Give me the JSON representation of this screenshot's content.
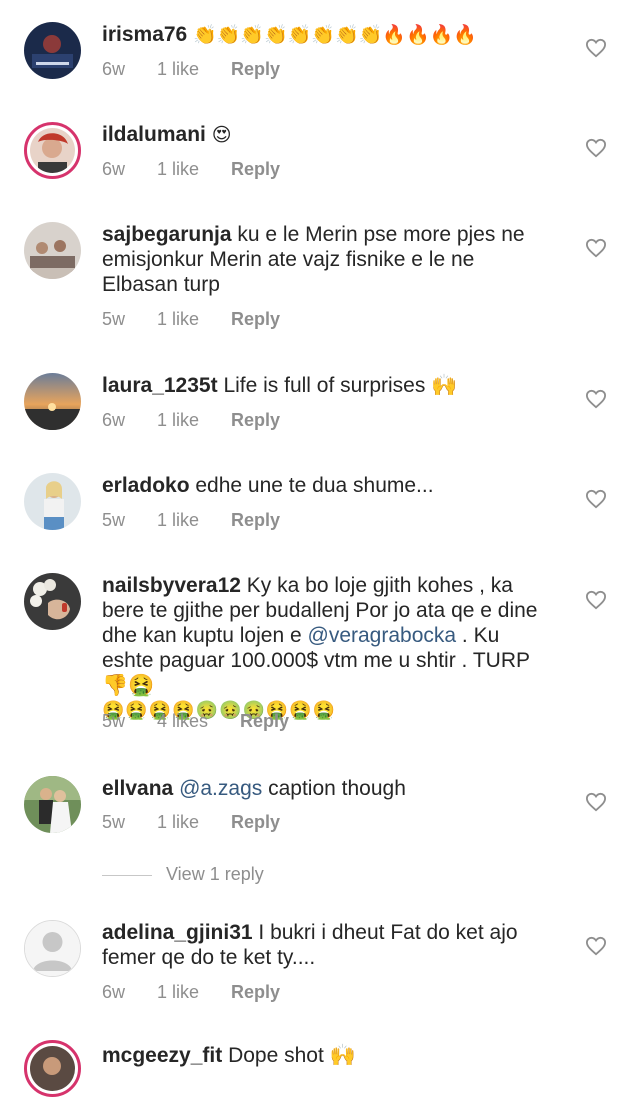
{
  "comments": [
    {
      "username": "irisma76",
      "text": "👏👏👏👏👏👏👏👏🔥🔥🔥🔥",
      "time": "6w",
      "likes": "1 like",
      "reply": "Reply"
    },
    {
      "username": "ildalumani",
      "text": "😍",
      "time": "6w",
      "likes": "1 like",
      "reply": "Reply"
    },
    {
      "username": "sajbegarunja",
      "text": "ku e le Merin pse more pjes ne emisjonkur Merin ate vajz fisnike e le ne Elbasan turp",
      "time": "5w",
      "likes": "1 like",
      "reply": "Reply"
    },
    {
      "username": "laura_1235t",
      "text": "Life is full of surprises 🙌",
      "time": "6w",
      "likes": "1 like",
      "reply": "Reply"
    },
    {
      "username": "erladoko",
      "text": "edhe une te dua shume...",
      "time": "5w",
      "likes": "1 like",
      "reply": "Reply"
    },
    {
      "username": "nailsbyvera12",
      "text_before": "Ky ka bo loje gjith kohes , ka bere te gjithe per budallenj Por jo ata qe e dine dhe kan kuptu lojen e",
      "mention": "@veragrabocka",
      "text_after": ". Ku eshte paguar 100.000$ vtm me u shtir . TURP 👎🤮",
      "emoji_line": "🤮🤮🤮🤮🤢🤢🤢🤮🤮🤮",
      "time": "5w",
      "likes": "4 likes",
      "reply": "Reply"
    },
    {
      "username": "ellvana",
      "mention": "@a.zags",
      "text_after": "caption though",
      "time": "5w",
      "likes": "1 like",
      "reply": "Reply"
    },
    {
      "username": "adelina_gjini31",
      "text": "I bukri i dheut  Fat do ket ajo femer qe do te ket  ty....",
      "time": "6w",
      "likes": "1 like",
      "reply": "Reply"
    },
    {
      "username": "mcgeezy_fit",
      "text": "Dope shot 🙌"
    }
  ],
  "view_replies": "View 1 reply",
  "colors": {
    "username": "#262626",
    "meta": "#8e8e8e",
    "mention": "#375a7f",
    "story_ring": "#d6336c"
  },
  "icons": {
    "like": "heart-outline-icon"
  }
}
